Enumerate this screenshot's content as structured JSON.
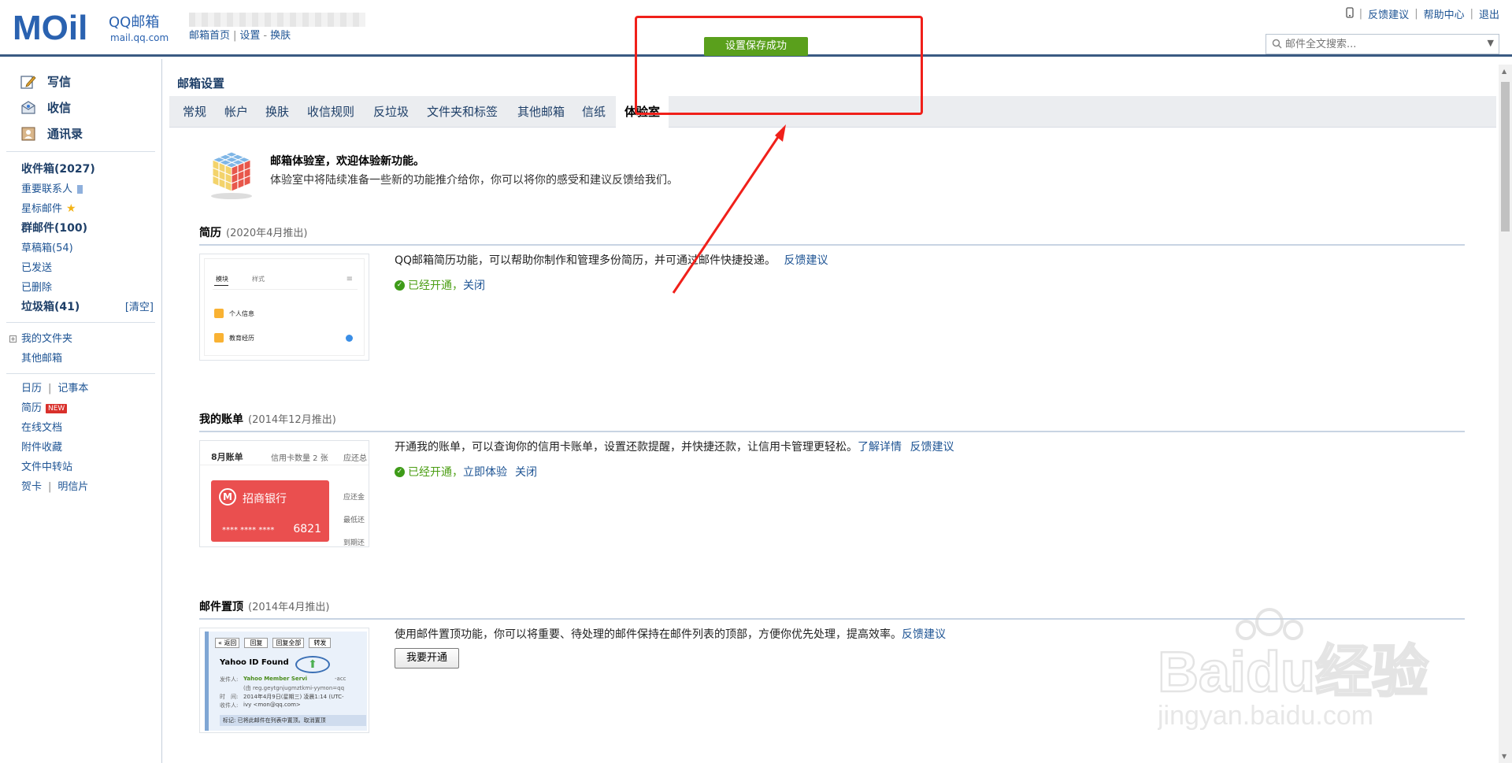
{
  "brand": {
    "logo_text": "MOil",
    "logo_cn": "QQ邮箱",
    "logo_domain": "mail.qq.com"
  },
  "top_nav": {
    "home": "邮箱首页",
    "sep": "|",
    "settings": "设置",
    "dash": "-",
    "skin": "换肤"
  },
  "top_right": {
    "feedback": "反馈建议",
    "help": "帮助中心",
    "logout": "退出",
    "sep": "|"
  },
  "search": {
    "placeholder": "邮件全文搜索..."
  },
  "toast": "设置保存成功",
  "sidebar": {
    "compose": "写信",
    "receive": "收信",
    "contacts": "通讯录",
    "inbox": "收件箱(2027)",
    "vip": "重要联系人",
    "starred": "星标邮件",
    "group": "群邮件(100)",
    "drafts": "草稿箱(54)",
    "sent": "已发送",
    "deleted": "已删除",
    "spam": "垃圾箱(41)",
    "spam_clear": "[清空]",
    "my_folders": "我的文件夹",
    "other_mailboxes": "其他邮箱",
    "calendar": "日历",
    "notes": "记事本",
    "resume": "简历",
    "new_badge": "NEW",
    "online_docs": "在线文档",
    "attachments": "附件收藏",
    "file_transfer": "文件中转站",
    "cards": "贺卡",
    "postcards": "明信片",
    "sep": "|"
  },
  "main": {
    "title": "邮箱设置",
    "tabs": [
      "常规",
      "帐户",
      "换肤",
      "收信规则",
      "反垃圾",
      "文件夹和标签",
      "其他邮箱",
      "信纸",
      "体验室"
    ],
    "intro_title": "邮箱体验室，欢迎体验新功能。",
    "intro_desc": "体验室中将陆续准备一些新的功能推介给你，你可以将你的感受和建议反馈给我们。",
    "sections": [
      {
        "name": "简历",
        "date": "(2020年4月推出)",
        "desc": "QQ邮箱简历功能，可以帮助你制作和管理多份简历，并可通过邮件快捷投递。",
        "feedback": "反馈建议",
        "status": "已经开通，",
        "close": "关闭",
        "thumb": {
          "tab1": "模块",
          "tab2": "样式",
          "row1": "个人信息",
          "row2": "教育经历"
        }
      },
      {
        "name": "我的账单",
        "date": "(2014年12月推出)",
        "desc": "开通我的账单，可以查询你的信用卡账单，设置还款提醒，并快捷还款，让信用卡管理更轻松。",
        "details": "了解详情",
        "feedback": "反馈建议",
        "status": "已经开通，",
        "try": "立即体验",
        "close": "关闭",
        "thumb": {
          "month": "8月账单",
          "count": "信用卡数量 2 张",
          "due": "应还总",
          "bank": "招商银行",
          "card": "**** **** ****",
          "last4": "6821",
          "r1": "应还金",
          "r2": "最低还",
          "r3": "到期还"
        }
      },
      {
        "name": "邮件置顶",
        "date": "(2014年4月推出)",
        "desc": "使用邮件置顶功能，你可以将重要、待处理的邮件保持在邮件列表的顶部，方便你优先处理，提高效率。",
        "feedback": "反馈建议",
        "button": "我要开通",
        "thumb": {
          "back": "« 返回",
          "reply": "回复",
          "reply_all": "回复全部",
          "forward": "转发",
          "subject": "Yahoo ID Found",
          "from_label": "发件人:",
          "from": "Yahoo Member Servi",
          "from_tail": "-acc",
          "addr": "(由 reg.geytgnjugmztkmi-yymon=qq",
          "time_label": "时　间:",
          "time": "2014年4月9日(星期三) 凌晨1:14 (UTC-",
          "to_label": "收件人:",
          "to": "ivy <mon@qq.com>",
          "tag": "标记: 已将此邮件在列表中置顶。取消置顶"
        }
      }
    ]
  },
  "watermark": {
    "text": "Baidu经验",
    "url": "jingyan.baidu.com"
  },
  "colors": {
    "accent": "#1e5494",
    "toast_bg": "#5aa01c",
    "annotation": "#f0201a",
    "status_green": "#4b9e13"
  }
}
